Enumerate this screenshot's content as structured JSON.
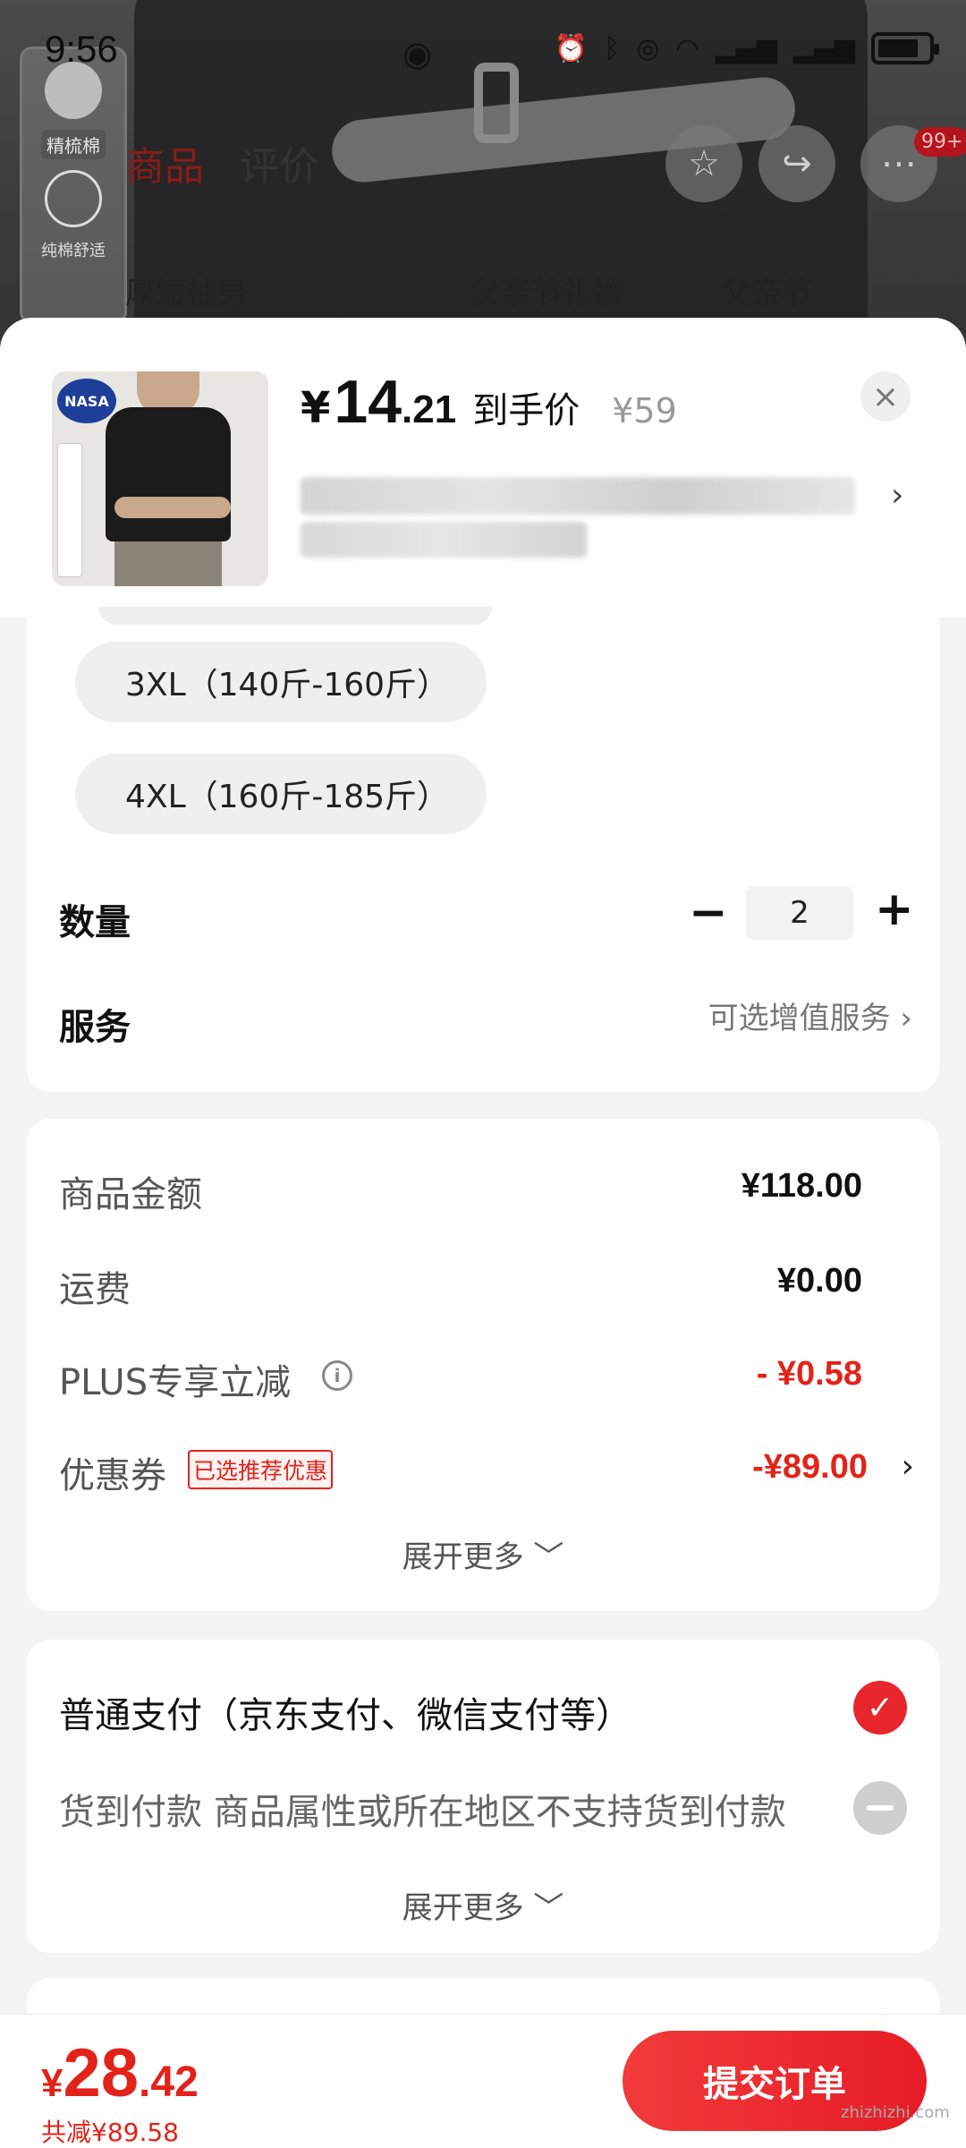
{
  "status_bar": {
    "time": "9:56",
    "icons": [
      "eye-icon",
      "alarm-icon",
      "bluetooth-icon",
      "hotspot-icon",
      "wifi-icon",
      "signal-4g-icon",
      "signal-4g-icon",
      "battery-icon"
    ]
  },
  "background": {
    "thumb_tag": "精梳棉",
    "thumb_small": "纯棉舒适",
    "tabs": [
      "商品",
      "评价"
    ],
    "badge": "99+",
    "search_terms": [
      "厚短袖男",
      "父亲节礼物",
      "父亲节"
    ]
  },
  "sheet": {
    "price": {
      "currency": "¥",
      "integer": "14",
      "decimal": ".21",
      "label": "到手价",
      "original": "¥59"
    },
    "close_label": "×",
    "image_logo": "NASA"
  },
  "sizes": [
    "3XL（140斤-160斤）",
    "4XL（160斤-185斤）"
  ],
  "quantity": {
    "label": "数量",
    "value": "2",
    "minus": "−",
    "plus": "+"
  },
  "service": {
    "label": "服务",
    "link": "可选增值服务 ›"
  },
  "amounts": {
    "goods_label": "商品金额",
    "goods_value": "¥118.00",
    "shipping_label": "运费",
    "shipping_value": "¥0.00",
    "plus_label": "PLUS专享立减",
    "plus_value": "- ¥0.58",
    "coupon_label": "优惠券",
    "coupon_tag": "已选推荐优惠",
    "coupon_value": "-¥89.00",
    "expand": "展开更多 ﹀"
  },
  "payment": {
    "normal": "普通支付（京东支付、微信支付等）",
    "cod": "货到付款   商品属性或所在地区不支持货到付款",
    "expand": "展开更多 ﹀"
  },
  "bottom": {
    "currency": "¥",
    "total_int": "28",
    "total_dec": ".42",
    "saved": "共减¥89.58",
    "submit": "提交订单",
    "watermark": "zhizhizhi.com"
  },
  "colors": {
    "accent_red": "#e2231a",
    "button_red": "#e61c26"
  }
}
